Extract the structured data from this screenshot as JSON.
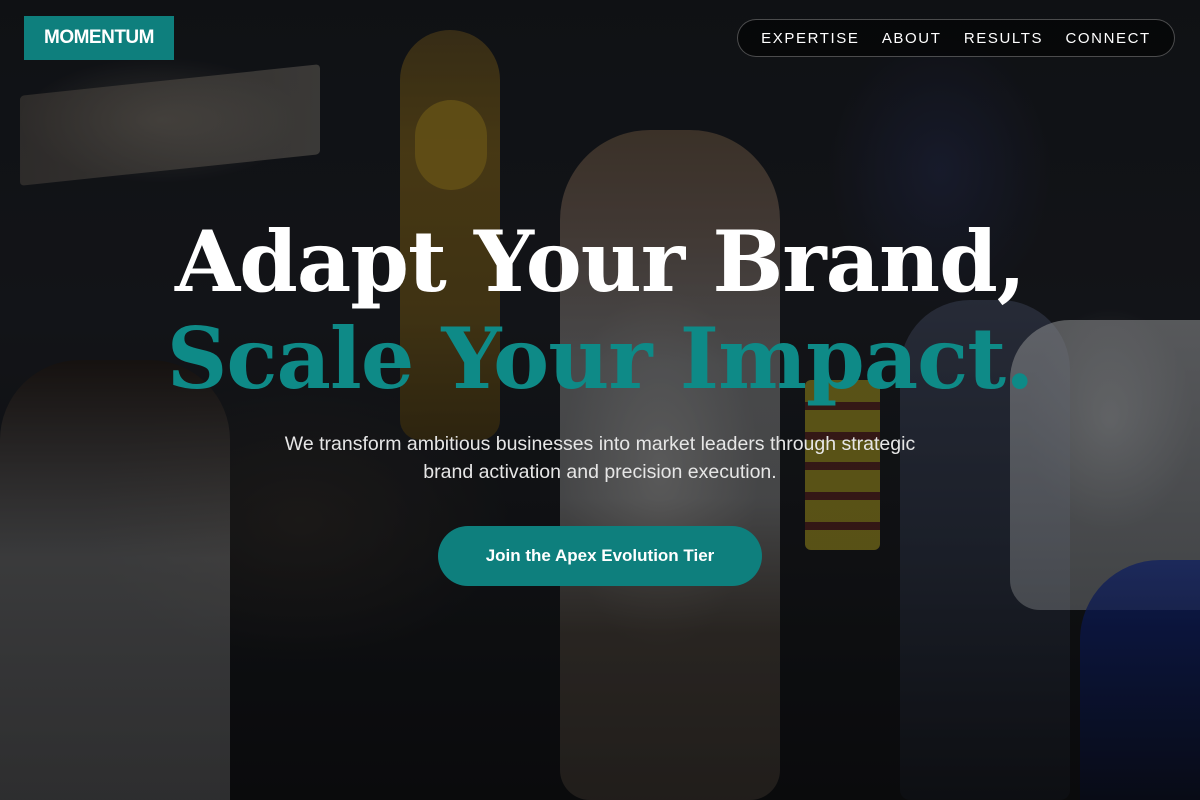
{
  "header": {
    "logo_text": "MOMENTUM",
    "nav_items": [
      {
        "label": "EXPERTISE"
      },
      {
        "label": "ABOUT"
      },
      {
        "label": "RESULTS"
      },
      {
        "label": "CONNECT"
      }
    ]
  },
  "hero": {
    "headline_line1": "Adapt Your Brand,",
    "headline_line2": "Scale Your Impact.",
    "subtitle": "We transform ambitious businesses into market leaders through strategic brand activation and precision execution.",
    "cta_label": "Join the Apex Evolution Tier"
  },
  "colors": {
    "accent": "#0e7f7d",
    "headline_accent": "#0e8a87",
    "text_primary": "#ffffff"
  }
}
